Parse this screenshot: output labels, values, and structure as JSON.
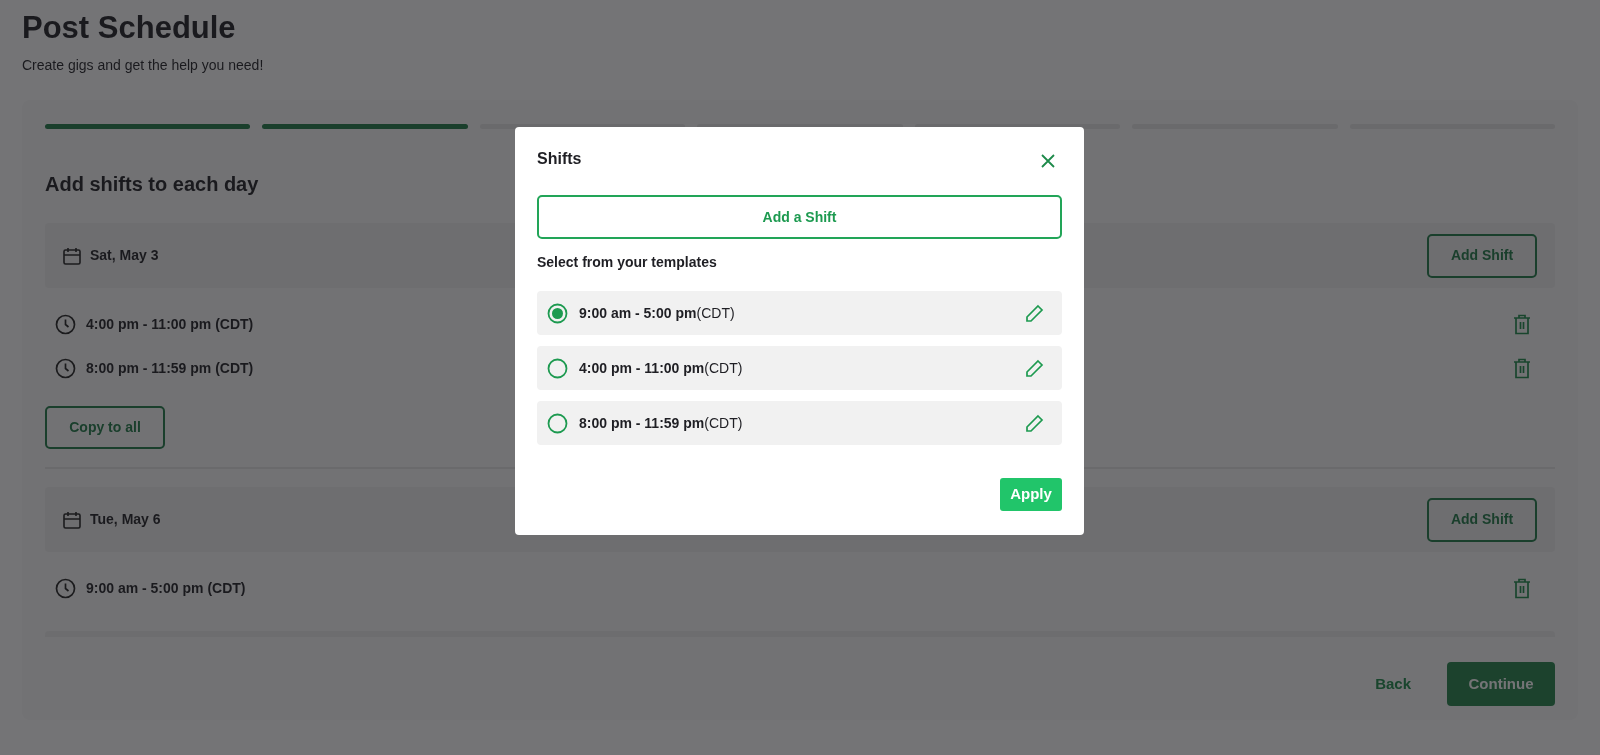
{
  "header": {
    "title": "Post Schedule",
    "subtitle": "Create gigs and get the help you need!"
  },
  "progress": [
    {
      "complete": true
    },
    {
      "complete": true
    },
    {
      "complete": false
    },
    {
      "complete": false
    },
    {
      "complete": false
    },
    {
      "complete": false
    },
    {
      "complete": false
    }
  ],
  "section_title": "Add shifts to each day",
  "days": [
    {
      "date": "Sat, May 3",
      "add_button": "Add Shift",
      "shifts": [
        "4:00 pm - 11:00 pm (CDT)",
        "8:00 pm - 11:59 pm (CDT)"
      ],
      "copy_button": "Copy to all"
    },
    {
      "date": "Tue, May 6",
      "add_button": "Add Shift",
      "shifts": [
        "9:00 am - 5:00 pm (CDT)"
      ]
    }
  ],
  "footer": {
    "back": "Back",
    "continue": "Continue"
  },
  "modal": {
    "title": "Shifts",
    "add_button": "Add a Shift",
    "templates_label": "Select from your templates",
    "templates": [
      {
        "label": "**9:00 am - 5:00 pm**(CDT)",
        "selected": true
      },
      {
        "label": "**4:00 pm - 11:00 pm**(CDT)",
        "selected": false
      },
      {
        "label": "**8:00 pm - 11:59 pm**(CDT)",
        "selected": false
      }
    ],
    "apply": "Apply"
  }
}
